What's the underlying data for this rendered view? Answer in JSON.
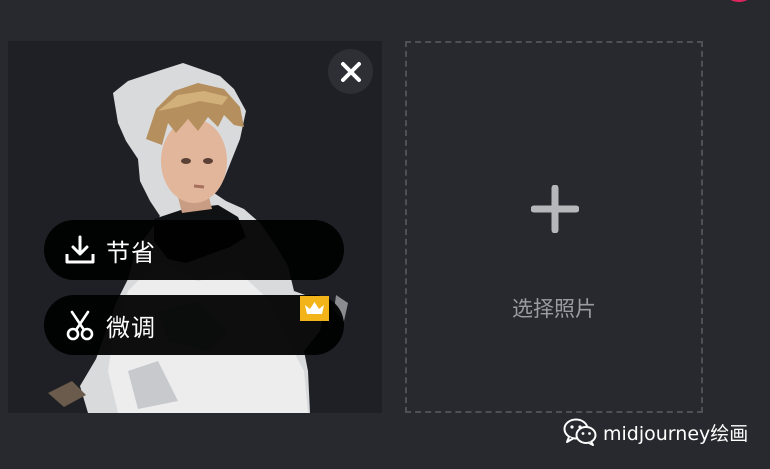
{
  "actions": {
    "save_label": "节省",
    "tune_label": "微调",
    "save_icon": "download-icon",
    "tune_icon": "scissors-icon",
    "vip_icon": "crown-icon"
  },
  "upload": {
    "label": "选择照片",
    "icon": "plus-icon"
  },
  "watermark": {
    "text": "midjourney绘画",
    "icon": "wechat-icon"
  },
  "colors": {
    "background": "#27292e",
    "card": "#1e2025",
    "pill": "#000000",
    "vip_badge": "#f2b418",
    "dashed_border": "#4d5056",
    "upload_text": "#9a9ca1",
    "accent": "#e0245e"
  }
}
